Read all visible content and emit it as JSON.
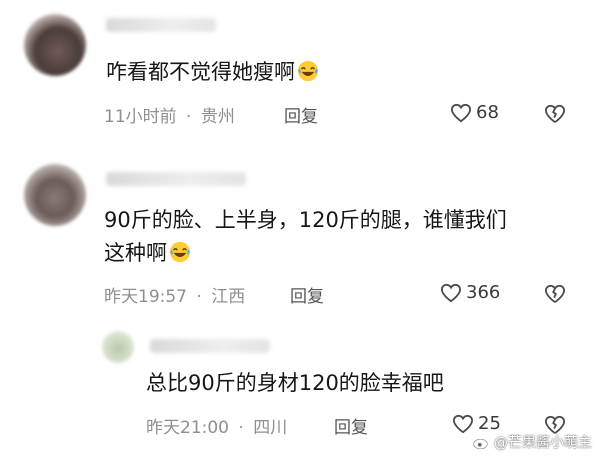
{
  "comments": [
    {
      "content": "咋看都不觉得她瘦啊",
      "emoji": "laugh-cry-emoji",
      "time": "11小时前",
      "location": "贵州",
      "separator": "·",
      "reply_label": "回复",
      "likes": "68"
    },
    {
      "content_line1": "90斤的脸、上半身，120斤的腿，谁懂我们",
      "content_line2": "这种啊",
      "emoji": "laugh-cry-emoji",
      "time": "昨天19:57",
      "location": "江西",
      "separator": "·",
      "reply_label": "回复",
      "likes": "366"
    },
    {
      "content": "总比90斤的身材120的脸幸福吧",
      "time": "昨天21:00",
      "location": "四川",
      "separator": "·",
      "reply_label": "回复",
      "likes": "25",
      "is_reply": true
    }
  ],
  "watermark": {
    "text": "@芒果酱小萌主",
    "icon": "weibo-icon"
  },
  "colors": {
    "text": "#161616",
    "meta": "#8f8f8f",
    "icon": "#4a4a4a"
  }
}
